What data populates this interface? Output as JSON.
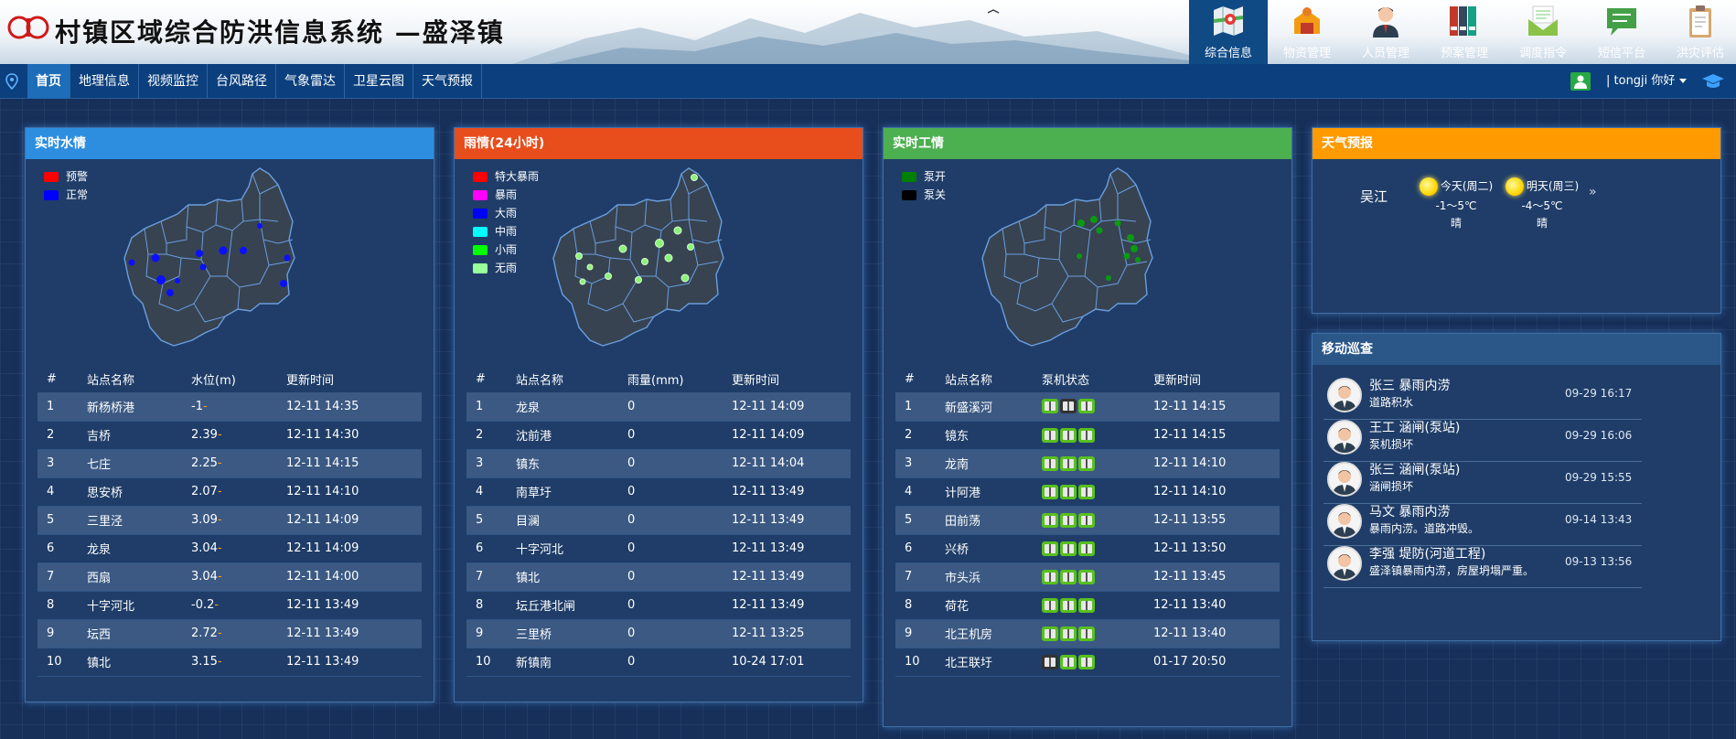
{
  "header": {
    "title": "村镇区域综合防洪信息系统 —盛泽镇"
  },
  "modules": [
    {
      "label": "综合信息",
      "icon": "map-icon",
      "active": true
    },
    {
      "label": "物资管理",
      "icon": "warehouse-icon"
    },
    {
      "label": "人员管理",
      "icon": "person-icon"
    },
    {
      "label": "预案管理",
      "icon": "binders-icon"
    },
    {
      "label": "调度指令",
      "icon": "mail-icon"
    },
    {
      "label": "短信平台",
      "icon": "chat-icon"
    },
    {
      "label": "洪灾评估",
      "icon": "clipboard-icon"
    }
  ],
  "nav": {
    "items": [
      "首页",
      "地理信息",
      "视频监控",
      "台风路径",
      "气象雷达",
      "卫星云图",
      "天气预报"
    ],
    "active": "首页"
  },
  "user": {
    "greeting": "| tongji  你好"
  },
  "water": {
    "title": "实时水情",
    "legend": [
      {
        "label": "预警",
        "color": "#ff0000"
      },
      {
        "label": "正常",
        "color": "#0000ff"
      }
    ],
    "columns": [
      "#",
      "站点名称",
      "水位(m)",
      "更新时间"
    ],
    "rows": [
      {
        "no": "1",
        "name": "新杨桥港",
        "value": "-1",
        "time": "12-11 14:35"
      },
      {
        "no": "2",
        "name": "吉桥",
        "value": "2.39",
        "time": "12-11 14:30"
      },
      {
        "no": "3",
        "name": "七庄",
        "value": "2.25",
        "time": "12-11 14:15"
      },
      {
        "no": "4",
        "name": "思安桥",
        "value": "2.07",
        "time": "12-11 14:10"
      },
      {
        "no": "5",
        "name": "三里泾",
        "value": "3.09",
        "time": "12-11 14:09"
      },
      {
        "no": "6",
        "name": "龙泉",
        "value": "3.04",
        "time": "12-11 14:09"
      },
      {
        "no": "7",
        "name": "西扇",
        "value": "3.04",
        "time": "12-11 14:00"
      },
      {
        "no": "8",
        "name": "十字河北",
        "value": "-0.2",
        "time": "12-11 13:49"
      },
      {
        "no": "9",
        "name": "坛西",
        "value": "2.72",
        "time": "12-11 13:49"
      },
      {
        "no": "10",
        "name": "镇北",
        "value": "3.15",
        "time": "12-11 13:49"
      }
    ]
  },
  "rain": {
    "title": "雨情(24小时)",
    "legend": [
      {
        "label": "特大暴雨",
        "color": "#ff0000"
      },
      {
        "label": "暴雨",
        "color": "#ff00ff"
      },
      {
        "label": "大雨",
        "color": "#0000ff"
      },
      {
        "label": "中雨",
        "color": "#00ffff"
      },
      {
        "label": "小雨",
        "color": "#00ff00"
      },
      {
        "label": "无雨",
        "color": "#99ff99"
      }
    ],
    "columns": [
      "#",
      "站点名称",
      "雨量(mm)",
      "更新时间"
    ],
    "rows": [
      {
        "no": "1",
        "name": "龙泉",
        "value": "0",
        "time": "12-11 14:09"
      },
      {
        "no": "2",
        "name": "沈前港",
        "value": "0",
        "time": "12-11 14:09"
      },
      {
        "no": "3",
        "name": "镇东",
        "value": "0",
        "time": "12-11 14:04"
      },
      {
        "no": "4",
        "name": "南草圩",
        "value": "0",
        "time": "12-11 13:49"
      },
      {
        "no": "5",
        "name": "目澜",
        "value": "0",
        "time": "12-11 13:49"
      },
      {
        "no": "6",
        "name": "十字河北",
        "value": "0",
        "time": "12-11 13:49"
      },
      {
        "no": "7",
        "name": "镇北",
        "value": "0",
        "time": "12-11 13:49"
      },
      {
        "no": "8",
        "name": "坛丘港北闸",
        "value": "0",
        "time": "12-11 13:49"
      },
      {
        "no": "9",
        "name": "三里桥",
        "value": "0",
        "time": "12-11 13:25"
      },
      {
        "no": "10",
        "name": "新镇南",
        "value": "0",
        "time": "10-24 17:01"
      }
    ]
  },
  "work": {
    "title": "实时工情",
    "legend": [
      {
        "label": "泵开",
        "color": "#008000"
      },
      {
        "label": "泵关",
        "color": "#000000"
      }
    ],
    "columns": [
      "#",
      "站点名称",
      "泵机状态",
      "更新时间"
    ],
    "rows": [
      {
        "no": "1",
        "name": "新盛溪河",
        "pumps": [
          "on",
          "off",
          "on"
        ],
        "time": "12-11 14:15"
      },
      {
        "no": "2",
        "name": "镜东",
        "pumps": [
          "on",
          "on",
          "on"
        ],
        "time": "12-11 14:15"
      },
      {
        "no": "3",
        "name": "龙南",
        "pumps": [
          "on",
          "on",
          "on"
        ],
        "time": "12-11 14:10"
      },
      {
        "no": "4",
        "name": "计阿港",
        "pumps": [
          "on",
          "on",
          "on"
        ],
        "time": "12-11 14:10"
      },
      {
        "no": "5",
        "name": "田前荡",
        "pumps": [
          "on",
          "on",
          "on"
        ],
        "time": "12-11 13:55"
      },
      {
        "no": "6",
        "name": "兴桥",
        "pumps": [
          "on",
          "on",
          "on"
        ],
        "time": "12-11 13:50"
      },
      {
        "no": "7",
        "name": "市头浜",
        "pumps": [
          "on",
          "on",
          "on"
        ],
        "time": "12-11 13:45"
      },
      {
        "no": "8",
        "name": "荷花",
        "pumps": [
          "on",
          "on",
          "on"
        ],
        "time": "12-11 13:40"
      },
      {
        "no": "9",
        "name": "北王机房",
        "pumps": [
          "on",
          "on",
          "on"
        ],
        "time": "12-11 13:40"
      },
      {
        "no": "10",
        "name": "北王联圩",
        "pumps": [
          "off",
          "on",
          "on"
        ],
        "time": "01-17 20:50"
      }
    ]
  },
  "weather": {
    "title": "天气预报",
    "city": "吴江",
    "days": [
      {
        "label": "今天(周二)",
        "temp": "-1～5℃",
        "desc": "晴"
      },
      {
        "label": "明天(周三)",
        "temp": "-4～5℃",
        "desc": "晴"
      }
    ],
    "more": "»"
  },
  "patrol": {
    "title": "移动巡查",
    "items": [
      {
        "title": "张三 暴雨内涝",
        "desc": "道路积水",
        "time": "09-29 16:17"
      },
      {
        "title": "王工 涵闸(泵站)",
        "desc": "泵机损坏",
        "time": "09-29 16:06"
      },
      {
        "title": "张三 涵闸(泵站)",
        "desc": "涵闸损坏",
        "time": "09-29 15:55"
      },
      {
        "title": "马文 暴雨内涝",
        "desc": "暴雨内涝。道路冲毁。",
        "time": "09-14 13:43"
      },
      {
        "title": "李强 堤防(河道工程)",
        "desc": "盛泽镇暴雨内涝，房屋坍塌严重。",
        "time": "09-13 13:56"
      }
    ]
  },
  "colors": {
    "water_header": "#2d8ee0",
    "rain_header": "#e84d1c",
    "work_header": "#4caf50",
    "weather_header": "#ff9a00",
    "patrol_header": "#2a5688",
    "nav": "#0b3f7d",
    "active_module": "#0f4a85"
  }
}
